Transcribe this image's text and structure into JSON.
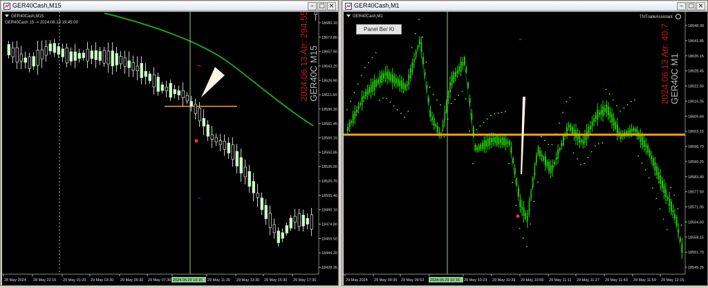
{
  "left": {
    "title": "GER40Cash,M15",
    "chart_label": "GER40Cash,M15",
    "info": "GER40Cash  15 -> 2024.06.13 19:45:00",
    "overlay_red": "2024.06.13 Atr: 294.55",
    "overlay_gray": "GER40C M15",
    "price_labels": [
      "18680.10",
      "18672.80",
      "18657.50",
      "18642.20",
      "18626.90",
      "18611.60",
      "18596.30",
      "18581.45",
      "18566.15",
      "18550.85",
      "18535.55",
      "18520.70",
      "18505.40",
      "18490.10",
      "18474.80",
      "18459.50",
      "18444.20",
      "18428.35"
    ],
    "time_labels": [
      "28 May 2024",
      "28 May 22:15",
      "29 May 01:20",
      "29 May 03:30",
      "29 May 05:30",
      "29 May 07:30",
      "2024.05.29 10:15",
      "29 May 11:30",
      "29 May 13:30",
      "29 May 15:30",
      "29 May 17:30"
    ],
    "highlight_time": "2024.05.29 10:15"
  },
  "right": {
    "title": "GER40Cash,M1",
    "chart_label": "GER40Cash,M1",
    "indicator_label": "TNTradeAssistant",
    "panel_button": "Panel Be/ Kl",
    "overlay_red": "2024.06.13 Atr: 40.7",
    "overlay_gray": "GER40C M1",
    "price_labels": [
      "18648.30",
      "18641.85",
      "18635.15",
      "18628.45",
      "18622.50",
      "18616.05",
      "18609.60",
      "18603.15",
      "18596.70",
      "18590.25",
      "18583.80",
      "18577.50",
      "18571.05",
      "18564.60",
      "18558.15",
      "18551.70",
      "18545.25"
    ],
    "time_labels": [
      "29 May 2024",
      "29 May 09:35",
      "29 May 09:53",
      "2024.05.29 10:15",
      "29 May 10:23",
      "29 May 10:39",
      "29 May 10:55",
      "29 May 11:11",
      "29 May 11:27",
      "29 May 11:43",
      "29 May 11:59",
      "29 May 12:15"
    ],
    "highlight_time": "2024.05.29 10:15"
  },
  "colors": {
    "chart_bg": "#000000",
    "bull": "#ccffcc",
    "m1_bull": "#22dd00",
    "ma": "#1f9f1f",
    "level": "#ffa500",
    "crosshair": "#8fcf8f",
    "overlay_red": "#c01818",
    "overlay_gray": "#b8b8b8"
  },
  "icons": {
    "window_icon": "chart-window-icon",
    "minimize": "minimize-icon",
    "maximize": "maximize-icon",
    "close": "close-icon"
  }
}
